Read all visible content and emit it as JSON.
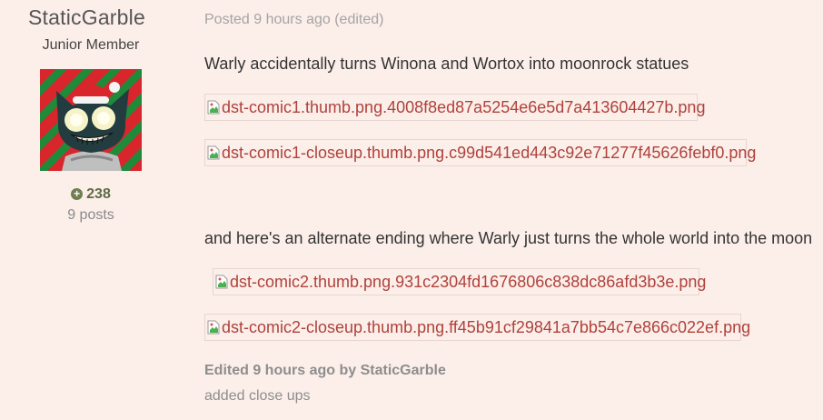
{
  "author": {
    "username": "StaticGarble",
    "rank": "Junior Member",
    "reputation": "238",
    "post_count": "9 posts"
  },
  "post": {
    "posted_label": "Posted 9 hours ago",
    "edited_tag": "(edited)",
    "line1": "Warly accidentally turns Winona and Wortox into moonrock statues",
    "line2": "and here's an alternate ending where Warly just turns the whole world into the moon",
    "images": [
      "dst-comic1.thumb.png.4008f8ed87a5254e6e5d7a413604427b.png",
      "dst-comic1-closeup.thumb.png.c99d541ed443c92e71277f45626febf0.png",
      "dst-comic2.thumb.png.931c2304fd1676806c838dc86afd3b3e.png",
      "dst-comic2-closeup.thumb.png.ff45b91cf29841a7bb54c7e866c022ef.png"
    ],
    "edited_prefix": "Edited 9 hours ago by",
    "edited_by": "StaticGarble",
    "edit_reason": "added close ups"
  },
  "icons": {
    "reputation": "plus-circle-icon",
    "broken_image": "broken-image-icon"
  },
  "colors": {
    "background": "#fcefea",
    "link": "#b0413b",
    "reputation": "#5d6b43"
  }
}
